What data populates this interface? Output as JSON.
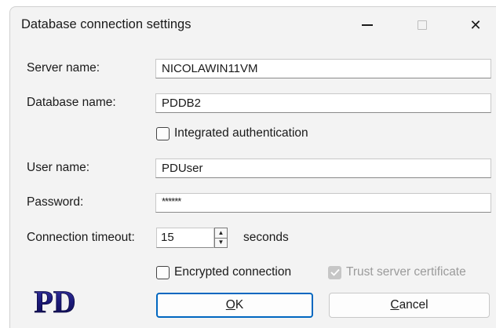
{
  "window": {
    "title": "Database connection settings",
    "minimize_icon": "minimize-icon",
    "maximize_icon": "maximize-icon",
    "close_icon": "close-icon",
    "close_glyph": "✕"
  },
  "form": {
    "server_label": "Server name:",
    "server_value": "NICOLAWIN11VM",
    "database_label": "Database name:",
    "database_value": "PDDB2",
    "integrated_auth_label": "Integrated authentication",
    "integrated_auth_checked": false,
    "user_label": "User name:",
    "user_value": "PDUser",
    "password_label": "Password:",
    "password_value": "******",
    "timeout_label": "Connection timeout:",
    "timeout_value": "15",
    "timeout_unit": "seconds",
    "encrypted_label": "Encrypted connection",
    "encrypted_checked": false,
    "trust_label": "Trust server certificate",
    "trust_checked": true,
    "trust_enabled": false
  },
  "logo": {
    "text": "PD",
    "color": "#1c1a7a"
  },
  "buttons": {
    "ok_mnemonic": "O",
    "ok_rest": "K",
    "cancel_mnemonic": "C",
    "cancel_rest": "ancel"
  },
  "colors": {
    "accent": "#0067c0",
    "window_bg": "#f3f3f3",
    "disabled": "#c6c6c6"
  }
}
